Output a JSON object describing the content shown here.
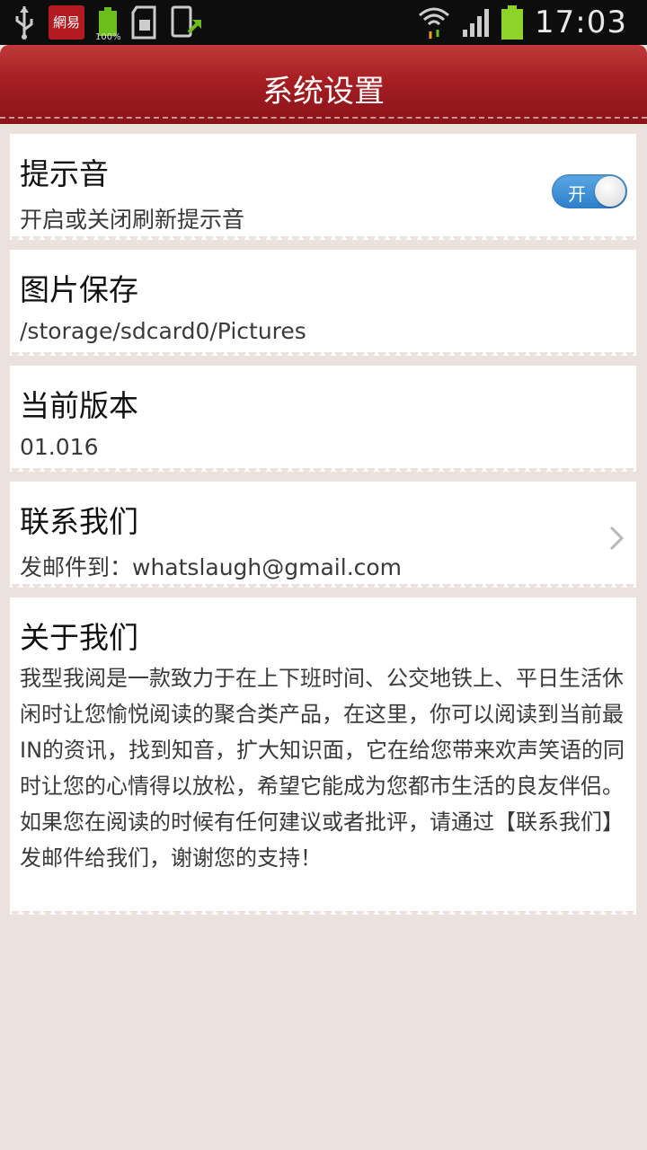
{
  "status_bar": {
    "time": "17:03",
    "battery_percent": "100%",
    "netease_logo_text": "網易",
    "icons": [
      "usb-icon",
      "netease-icon",
      "battery-icon",
      "sd-card-icon",
      "upload-icon",
      "wifi-icon",
      "signal-icon",
      "battery-full-icon"
    ]
  },
  "header": {
    "title": "系统设置"
  },
  "settings": {
    "sound": {
      "title": "提示音",
      "subtitle": "开启或关闭刷新提示音",
      "toggle_label": "开",
      "toggle_on": true
    },
    "save_path": {
      "title": "图片保存",
      "subtitle": "/storage/sdcard0/Pictures"
    },
    "version": {
      "title": "当前版本",
      "subtitle": "01.016"
    },
    "contact": {
      "title": "联系我们",
      "subtitle": "发邮件到：whatslaugh@gmail.com"
    },
    "about": {
      "title": "关于我们",
      "text": "我型我阅是一款致力于在上下班时间、公交地铁上、平日生活休闲时让您愉悦阅读的聚合类产品，在这里，你可以阅读到当前最IN的资讯，找到知音，扩大知识面，它在给您带来欢声笑语的同时让您的心情得以放松，希望它能成为您都市生活的良友伴侣。 如果您在阅读的时候有任何建议或者批评，请通过【联系我们】发邮件给我们，谢谢您的支持！"
    }
  },
  "colors": {
    "header_red": "#a51e22",
    "toggle_blue": "#2c7fc8",
    "background": "#ebe1dd"
  }
}
